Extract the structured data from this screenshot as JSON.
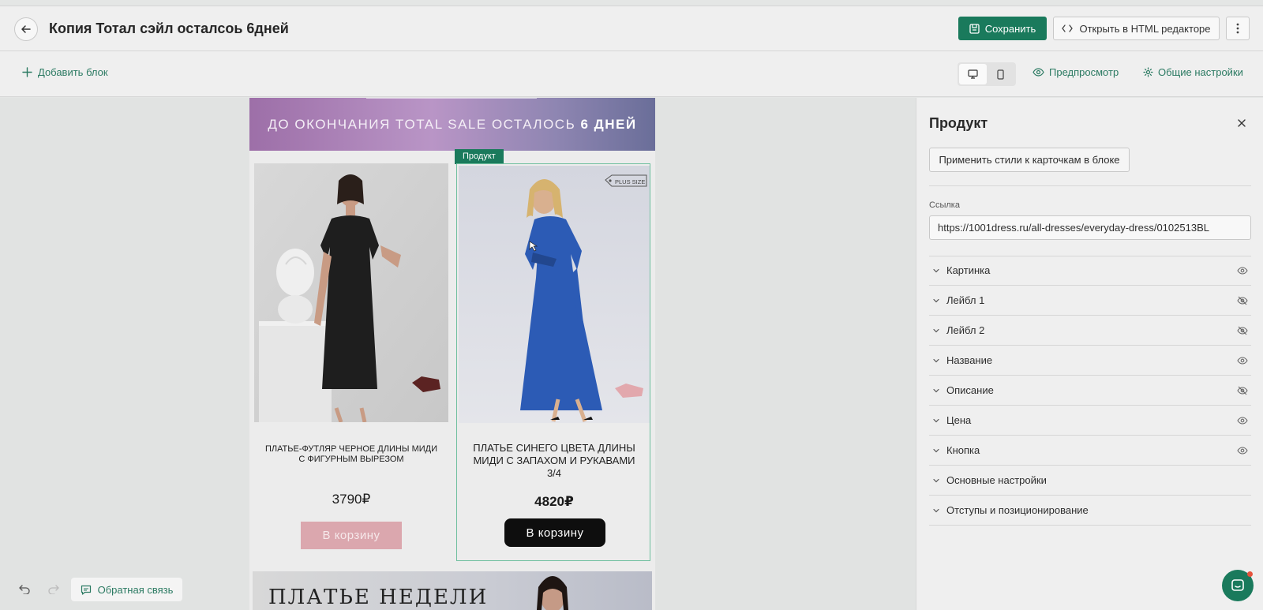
{
  "header": {
    "title": "Копия Тотал сэйл осталсоь 6дней",
    "save_label": "Сохранить",
    "html_editor_label": "Открыть в HTML редакторе"
  },
  "toolbar": {
    "add_block_label": "Добавить блок",
    "preview_label": "Предпросмотр",
    "settings_label": "Общие настройки",
    "device_selected": "desktop"
  },
  "email": {
    "banner_text": "До окончания Total Sale осталось",
    "banner_highlight": "6 дней",
    "selected_block_label": "Продукт",
    "products": [
      {
        "name": "Платье-футляр черное длины миди с фигурным вырезом",
        "price": "3790₽",
        "button_label": "В корзину",
        "dress_color": "#1e1e1e"
      },
      {
        "name": "Платье синего цвета длины миди с запахом и рукавами 3/4",
        "price": "4820₽",
        "button_label": "В корзину",
        "badge": "PLUS SIZE",
        "dress_color": "#2c5bb5"
      }
    ],
    "bottom_banner_text": "ПЛАТЬЕ НЕДЕЛИ"
  },
  "footer": {
    "feedback_label": "Обратная связь"
  },
  "panel": {
    "title": "Продукт",
    "apply_styles_label": "Применить стили к карточкам в блоке",
    "link_label": "Ссылка",
    "link_value": "https://1001dress.ru/all-dresses/everyday-dress/0102513BL",
    "sections": [
      {
        "label": "Картинка",
        "visibility": "visible"
      },
      {
        "label": "Лейбл 1",
        "visibility": "hidden"
      },
      {
        "label": "Лейбл 2",
        "visibility": "hidden"
      },
      {
        "label": "Название",
        "visibility": "visible"
      },
      {
        "label": "Описание",
        "visibility": "hidden"
      },
      {
        "label": "Цена",
        "visibility": "visible"
      },
      {
        "label": "Кнопка",
        "visibility": "visible"
      },
      {
        "label": "Основные настройки",
        "visibility": "none"
      },
      {
        "label": "Отступы и позиционирование",
        "visibility": "none"
      }
    ]
  },
  "colors": {
    "accent": "#1a7a5c",
    "link": "#2b7a62",
    "cart_primary": "#0e0e0e",
    "cart_muted": "#dba7ae"
  }
}
